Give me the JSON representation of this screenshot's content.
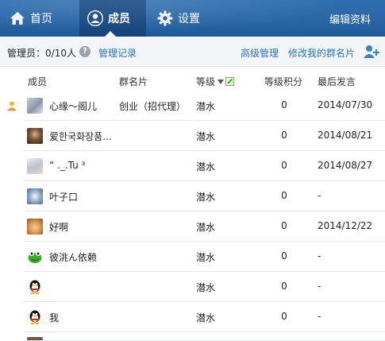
{
  "header": {
    "tabs": [
      {
        "label": "首页",
        "icon": "home-icon"
      },
      {
        "label": "成员",
        "icon": "person-icon",
        "active": true
      },
      {
        "label": "设置",
        "icon": "gear-icon"
      }
    ],
    "edit_profile": "编辑资料"
  },
  "toolbar": {
    "admin_count": "管理员：0/10人",
    "help": "?",
    "admin_log": "管理记录",
    "advanced": "高级管理",
    "modify_card": "修改我的群名片"
  },
  "table": {
    "columns": [
      "成员",
      "群名片",
      "等级",
      "等级积分",
      "最后发言"
    ],
    "rows": [
      {
        "name": "心缘～阁儿",
        "card": "创业（招代理）",
        "level": "潜水",
        "points": "0",
        "last": "2014/07/30",
        "owner": true,
        "avatar": "photo-gray"
      },
      {
        "name": "爱한국화장품...",
        "card": "",
        "level": "潜水",
        "points": "0",
        "last": "2014/08/21",
        "owner": false,
        "avatar": "photo-brown"
      },
      {
        "name": "“ ._.Tu ³",
        "card": "",
        "level": "潜水",
        "points": "0",
        "last": "2014/08/27",
        "owner": false,
        "avatar": "photo-light"
      },
      {
        "name": "叶子口",
        "card": "",
        "level": "潜水",
        "points": "0",
        "last": "-",
        "owner": false,
        "avatar": "photo-blue"
      },
      {
        "name": "好啊",
        "card": "",
        "level": "潜水",
        "points": "0",
        "last": "2014/12/22",
        "owner": false,
        "avatar": "cartoon"
      },
      {
        "name": "彼洮ん依赖",
        "card": "",
        "level": "潜水",
        "points": "0",
        "last": "-",
        "owner": false,
        "avatar": "frog"
      },
      {
        "name": "",
        "card": "",
        "level": "潜水",
        "points": "0",
        "last": "-",
        "owner": false,
        "avatar": "penguin"
      },
      {
        "name": "我",
        "card": "",
        "level": "潜水",
        "points": "0",
        "last": "-",
        "owner": false,
        "avatar": "penguin"
      }
    ]
  },
  "colors": {
    "header": "#2a66a6",
    "link": "#2a74c7",
    "toolbar_bg": "#f3f5f8"
  }
}
